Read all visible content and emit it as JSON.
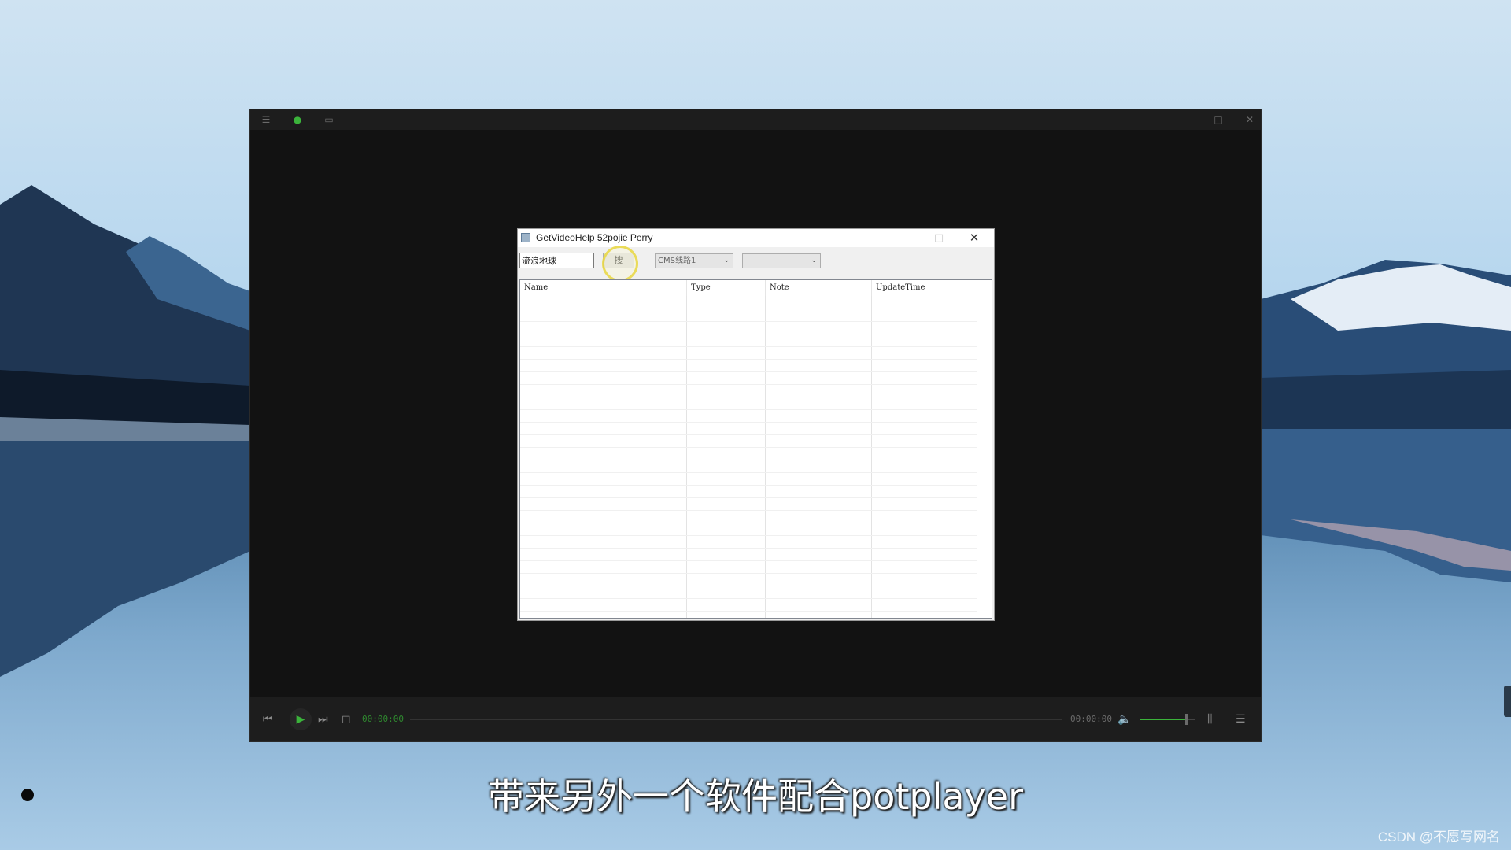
{
  "player": {
    "time_current": "00:00:00",
    "time_total": "00:00:00",
    "volume_level": 0.85
  },
  "dialog": {
    "title": "GetVideoHelp   52pojie Perry",
    "search_value": "流浪地球",
    "search_button_label": "搜",
    "source_combo_value": "CMS线路1",
    "second_combo_value": "",
    "columns": [
      "Name",
      "Type",
      "Note",
      "UpdateTime"
    ]
  },
  "subtitle": "带来另外一个软件配合potplayer",
  "watermark": "CSDN @不愿写网名",
  "colors": {
    "accent_green": "#3bb33b",
    "player_bg": "#121212",
    "dialog_bg": "#f0f0f0"
  }
}
